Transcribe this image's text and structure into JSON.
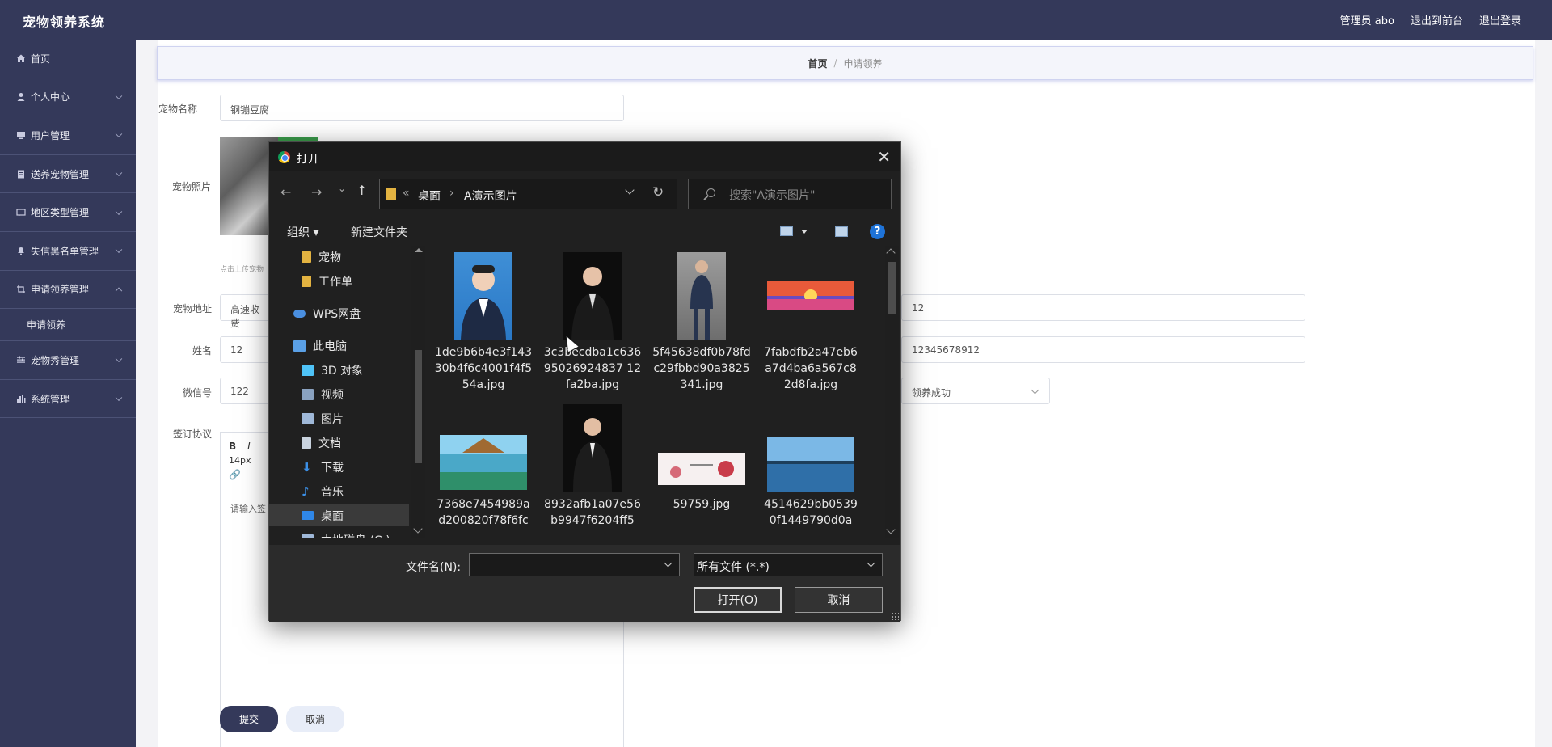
{
  "app": {
    "brand": "宠物领养系统",
    "admin": "管理员 abo",
    "back_front": "退出到前台",
    "logout": "退出登录"
  },
  "sidebar": {
    "items": [
      {
        "label": "首页",
        "icon": "home-icon"
      },
      {
        "label": "个人中心",
        "icon": "user-icon"
      },
      {
        "label": "用户管理",
        "icon": "monitor-icon"
      },
      {
        "label": "送养宠物管理",
        "icon": "clipboard-icon"
      },
      {
        "label": "地区类型管理",
        "icon": "chat-icon"
      },
      {
        "label": "失信黑名单管理",
        "icon": "bell-icon"
      },
      {
        "label": "申请领养管理",
        "icon": "crop-icon"
      },
      {
        "label": "宠物秀管理",
        "icon": "sliders-icon"
      },
      {
        "label": "系统管理",
        "icon": "bar-chart-icon"
      }
    ],
    "sub_item": "申请领养"
  },
  "breadcrumb": {
    "home": "首页",
    "sep": "/",
    "current": "申请领养"
  },
  "form": {
    "pet_name_label": "宠物名称",
    "pet_name_value": "钢镚豆腐",
    "pet_photo_label": "宠物照片",
    "upload_hint": "点击上传宠物",
    "address_label": "宠物地址",
    "address_value": "高速收费",
    "address_right_value": "12",
    "name_label": "姓名",
    "name_value": "12",
    "phone_value": "12345678912",
    "wechat_label": "微信号",
    "wechat_value": "122",
    "status_value": "领养成功",
    "agreement_label": "签订协议",
    "editor_size": "14px",
    "editor_placeholder": "请输入签",
    "submit": "提交",
    "cancel": "取消"
  },
  "dialog": {
    "title": "打开",
    "close": "✕",
    "path_chevrons": "«",
    "path_desktop": "桌面",
    "path_sep": "›",
    "path_folder": "A演示图片",
    "search_placeholder": "搜索\"A演示图片\"",
    "organize": "组织 ▾",
    "new_folder": "新建文件夹",
    "help": "?",
    "nav": [
      {
        "label": "宠物",
        "icon": "folder-icon",
        "color": "#e3b341"
      },
      {
        "label": "工作单",
        "icon": "folder-icon",
        "color": "#e3b341"
      },
      {
        "label": "WPS网盘",
        "icon": "cloud-icon",
        "color": "#4a8fe0"
      },
      {
        "label": "此电脑",
        "icon": "computer-icon",
        "color": "#5aa0e6"
      },
      {
        "label": "3D 对象",
        "icon": "cube-icon",
        "color": "#4fc3f7"
      },
      {
        "label": "视频",
        "icon": "video-icon",
        "color": "#8aa2c0"
      },
      {
        "label": "图片",
        "icon": "picture-icon",
        "color": "#9fb8d8"
      },
      {
        "label": "文档",
        "icon": "document-icon",
        "color": "#c9d3df"
      },
      {
        "label": "下载",
        "icon": "download-icon",
        "color": "#3b8fe6"
      },
      {
        "label": "音乐",
        "icon": "music-icon",
        "color": "#3b8fe6"
      },
      {
        "label": "桌面",
        "icon": "desktop-icon",
        "color": "#2f87e8"
      },
      {
        "label": "本地磁盘 (C:)",
        "icon": "disk-icon",
        "color": "#9fb8d8"
      }
    ],
    "files": [
      {
        "name": "1de9b6b4e3f14330b4f6c4001f4f554a.jpg",
        "kind": "portrait-blue"
      },
      {
        "name": "3c3becdba1c63695026924837 12fa2ba.jpg",
        "kind": "portrait-dark"
      },
      {
        "name": "5f45638df0b78fdc29fbbd90a3825341.jpg",
        "kind": "portrait-gray"
      },
      {
        "name": "7fabdfb2a47eb6a7d4ba6a567c82d8fa.jpg",
        "kind": "sunset"
      },
      {
        "name": "7368e7454989ad200820f78f6fc",
        "kind": "beach"
      },
      {
        "name": "8932afb1a07e56b9947f6204ff5",
        "kind": "portrait-dark"
      },
      {
        "name": "59759.jpg",
        "kind": "banner"
      },
      {
        "name": "4514629bb05390f1449790d0a",
        "kind": "lake"
      }
    ],
    "file_name_label": "文件名(N):",
    "file_name_value": "",
    "file_type": "所有文件 (*.*)",
    "open": "打开(O)",
    "cancel": "取消"
  }
}
